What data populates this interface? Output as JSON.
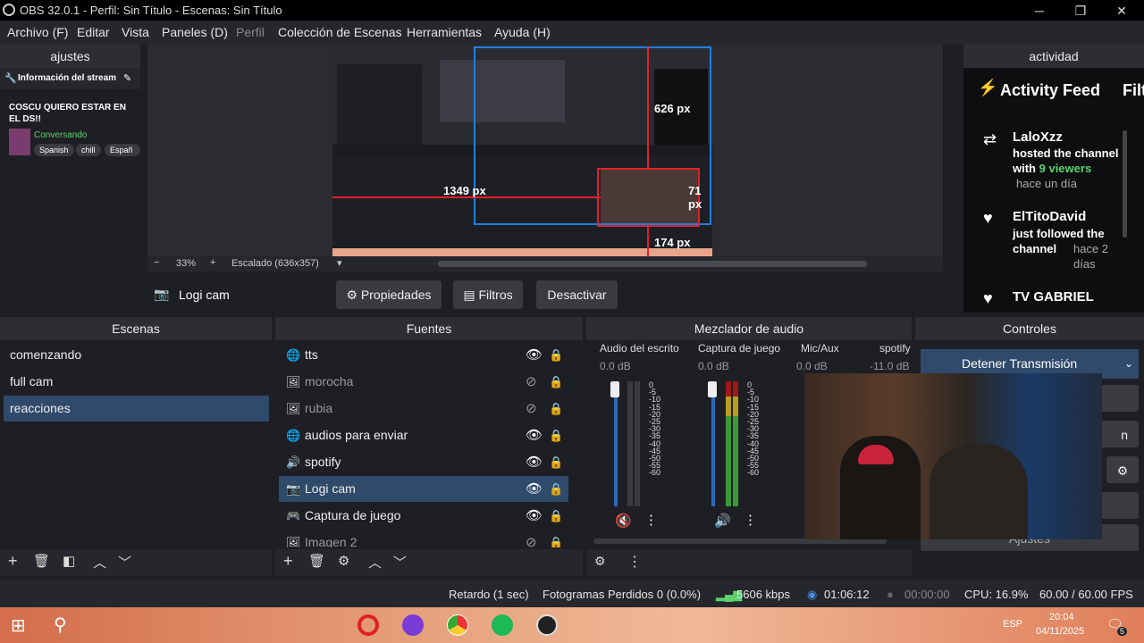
{
  "window": {
    "title": "OBS 32.0.1 - Perfil: Sin Título - Escenas: Sin Título",
    "minimize": "─",
    "restore": "❐",
    "close": "✕"
  },
  "menu": [
    "Archivo (F)",
    "Editar",
    "Vista",
    "Paneles (D)",
    "Perfil",
    "Colección de Escenas",
    "Herramientas",
    "Ayuda (H)"
  ],
  "left_dock": {
    "title": "ajustes",
    "stream_info": "Información del stream",
    "stream_title": "COSCU QUIERO ESTAR EN EL DS!!",
    "category": "Conversando",
    "tags": [
      "Spanish",
      "chill",
      "Españ"
    ]
  },
  "right_dock": {
    "title": "actividad",
    "feed_title": "Activity Feed",
    "feed_cut": "Filt",
    "events": [
      {
        "user": "LaloXzz",
        "text1": "hosted the channel with",
        "highlight": "9 viewers",
        "time": "hace un día"
      },
      {
        "user": "ElTitoDavid",
        "text1": "just followed the channel",
        "highlight": "",
        "time": "hace 2 días"
      },
      {
        "user": "TV GABRIEL",
        "text1": "",
        "highlight": "",
        "time": ""
      }
    ]
  },
  "preview": {
    "zoom": "33%",
    "scale_label": "Escalado (636x357)",
    "dim_left": "1349 px",
    "dim_right": "71 px",
    "dim_bottom": "174 px",
    "dim_top": "626 px"
  },
  "source_toolbar": {
    "source": "Logi cam",
    "properties": "Propiedades",
    "filters": "Filtros",
    "deactivate": "Desactivar"
  },
  "scenes": {
    "title": "Escenas",
    "items": [
      "comenzando",
      "full cam",
      "reacciones"
    ],
    "selected": 2
  },
  "sources": {
    "title": "Fuentes",
    "items": [
      {
        "name": "tts",
        "icon": "globe-icon",
        "visible": true
      },
      {
        "name": "morocha",
        "icon": "image-icon",
        "visible": false
      },
      {
        "name": "rubia",
        "icon": "image-icon",
        "visible": false
      },
      {
        "name": "audios para enviar",
        "icon": "globe-icon",
        "visible": true
      },
      {
        "name": "spotify",
        "icon": "speaker-icon",
        "visible": true
      },
      {
        "name": "Logi cam",
        "icon": "camera-icon",
        "visible": true
      },
      {
        "name": "Captura de juego",
        "icon": "gamepad-icon",
        "visible": true
      },
      {
        "name": "Imagen 2",
        "icon": "image-icon",
        "visible": false
      }
    ],
    "selected": 5
  },
  "mixer": {
    "title": "Mezclador de audio",
    "channels": [
      {
        "name": "Audio del escrito",
        "db": "0.0 dB",
        "muted": true
      },
      {
        "name": "Captura de juego",
        "db": "0.0 dB",
        "muted": false
      },
      {
        "name": "Mic/Aux",
        "db": "0.0 dB",
        "muted": false
      },
      {
        "name": "spotify",
        "db": "-11.0 dB",
        "muted": false
      }
    ],
    "scale": [
      "0",
      "-5",
      "-10",
      "-15",
      "-20",
      "-25",
      "-30",
      "-35",
      "-40",
      "-45",
      "-50",
      "-55",
      "-60"
    ]
  },
  "controls": {
    "title": "Controles",
    "stop_stream": "Detener Transmisión",
    "settings_partial": "Ajustes",
    "right_cut": "n"
  },
  "status": {
    "delay": "Retardo (1 sec)",
    "dropped": "Fotogramas Perdidos 0 (0.0%)",
    "bitrate": "5606 kbps",
    "stream_time": "01:06:12",
    "rec_time": "00:00:00",
    "cpu": "CPU: 16.9%",
    "fps": "60.00 / 60.00 FPS"
  },
  "taskbar": {
    "lang": "ESP",
    "time": "20:04",
    "date": "04/11/2025",
    "notif": "5"
  },
  "colors": {
    "accent": "#2f4a6a",
    "highlight_viewers": "#5bd36f",
    "category": "#5bd36f",
    "selection_red": "#e3202a",
    "selection_blue": "#1f7fe0"
  }
}
